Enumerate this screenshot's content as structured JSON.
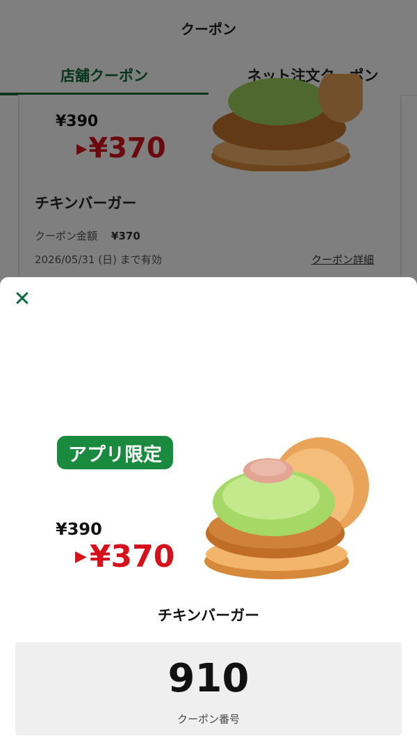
{
  "header": {
    "title": "クーポン"
  },
  "tabs": [
    {
      "label": "店舗クーポン",
      "active": true
    },
    {
      "label": "ネット注文クーポン",
      "active": false
    }
  ],
  "background_card": {
    "old_price": "¥390",
    "new_price": "¥370",
    "name": "チキンバーガー",
    "amount_label": "クーポン金額",
    "amount_value": "¥370",
    "expiry": "2026/05/31 (日) まで有効",
    "detail_link": "クーポン詳細"
  },
  "modal": {
    "close_icon": "close-icon",
    "badge": "アプリ限定",
    "old_price": "¥390",
    "new_price": "¥370",
    "price_arrow": "▶",
    "item_name": "チキンバーガー",
    "coupon_code": "910",
    "coupon_code_label": "クーポン番号"
  },
  "colors": {
    "brand_green": "#0a6b3a",
    "badge_green": "#1a8a3f",
    "price_red": "#d5121c",
    "code_box_bg": "#efefef"
  }
}
